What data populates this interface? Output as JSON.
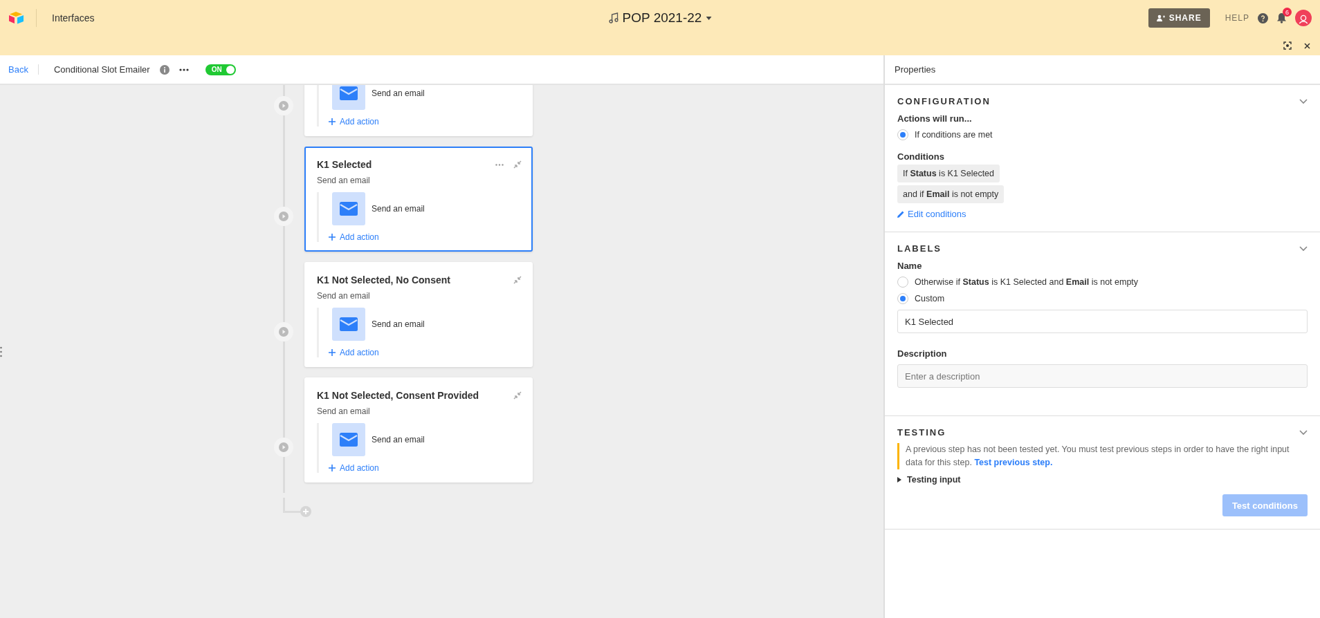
{
  "app_bar": {
    "section": "Interfaces",
    "base_title": "POP 2021-22",
    "share": "SHARE",
    "help": "HELP",
    "notifications": "6"
  },
  "toolbar": {
    "back": "Back",
    "automation_name": "Conditional Slot Emailer",
    "toggle": {
      "label": "ON",
      "on": true
    }
  },
  "branches": [
    {
      "selected": false,
      "actions": [
        {
          "label": "Send an email"
        }
      ],
      "add_action": "Add action"
    },
    {
      "title": "K1 Selected",
      "subtitle": "Send an email",
      "selected": true,
      "actions": [
        {
          "label": "Send an email"
        }
      ],
      "add_action": "Add action"
    },
    {
      "title": "K1 Not Selected, No Consent",
      "subtitle": "Send an email",
      "selected": false,
      "actions": [
        {
          "label": "Send an email"
        }
      ],
      "add_action": "Add action"
    },
    {
      "title": "K1 Not Selected, Consent Provided",
      "subtitle": "Send an email",
      "selected": false,
      "actions": [
        {
          "label": "Send an email"
        }
      ],
      "add_action": "Add action"
    }
  ],
  "properties": {
    "title": "Properties",
    "configuration": {
      "heading": "CONFIGURATION",
      "run_label": "Actions will run...",
      "run_options": [
        {
          "label": "If conditions are met",
          "selected": true
        }
      ],
      "conditions_label": "Conditions",
      "conditions": [
        "If **Status** is K1 Selected",
        "and if **Email** is not empty"
      ],
      "edit_link": "Edit conditions"
    },
    "labels": {
      "heading": "LABELS",
      "name_label": "Name",
      "name_options": [
        {
          "label": "Otherwise if **Status** is K1 Selected and **Email** is not empty",
          "selected": false
        },
        {
          "label": "Custom",
          "selected": true
        }
      ],
      "name_value": "K1 Selected",
      "description_label": "Description",
      "description_placeholder": "Enter a description"
    },
    "testing": {
      "heading": "TESTING",
      "warning": "A previous step has not been tested yet. You must test previous steps in order to have the right input data for this step.",
      "warning_link": "Test previous step.",
      "testing_input": "Testing input",
      "test_button": "Test conditions",
      "test_button_disabled": true
    }
  }
}
